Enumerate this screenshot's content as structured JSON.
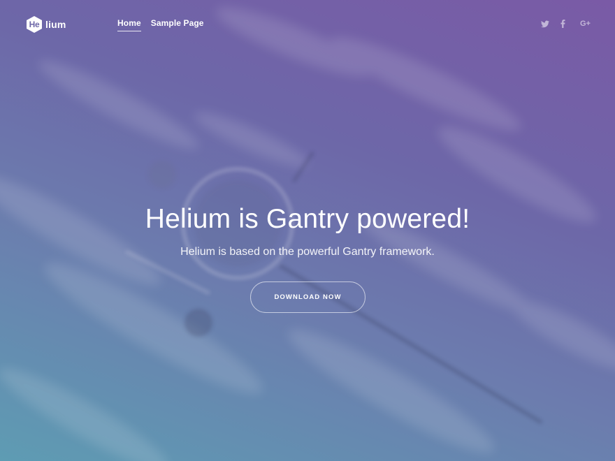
{
  "brand": {
    "logo_badge": "He",
    "logo_rest": "lium"
  },
  "nav": {
    "items": [
      {
        "label": "Home",
        "active": true
      },
      {
        "label": "Sample Page",
        "active": false
      }
    ]
  },
  "social": {
    "icons": [
      "twitter-icon",
      "facebook-icon",
      "google-plus-icon"
    ],
    "google_plus_text": "G+"
  },
  "hero": {
    "title": "Helium is Gantry powered!",
    "subtitle": "Helium is based on the powerful Gantry framework.",
    "cta_label": "Download Now"
  },
  "colors": {
    "gradient_top_right": "#7a5aa6",
    "gradient_mid": "#6d67a8",
    "gradient_bottom_left": "#5e9cb3",
    "text": "#ffffff"
  }
}
